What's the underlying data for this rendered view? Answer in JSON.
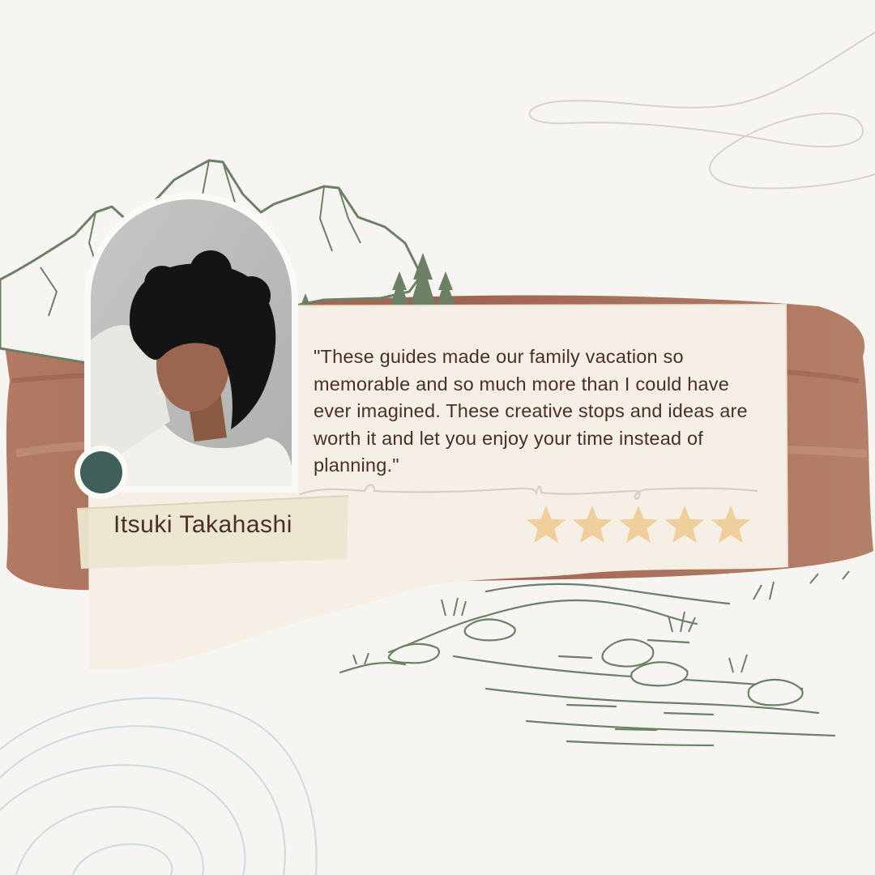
{
  "testimonial": {
    "quote": "\"These guides made our family vacation so memorable and so much more than I could have ever imagined. These creative stops and ideas are worth it and let you enjoy your time instead of planning.\"",
    "name": "Itsuki Takahashi",
    "rating": 5,
    "rating_max": 5
  },
  "colors": {
    "background": "#f6f5f1",
    "paper": "#f5efe6",
    "brush": "#a9705a",
    "sketch": "#6b8064",
    "text": "#4a2f27",
    "star": "#efcf9b",
    "accent_dot": "#3f5f5a"
  },
  "icons": [
    "mountain-sketch",
    "pine-trees",
    "river-sketch",
    "star-icon",
    "contour-lines"
  ]
}
